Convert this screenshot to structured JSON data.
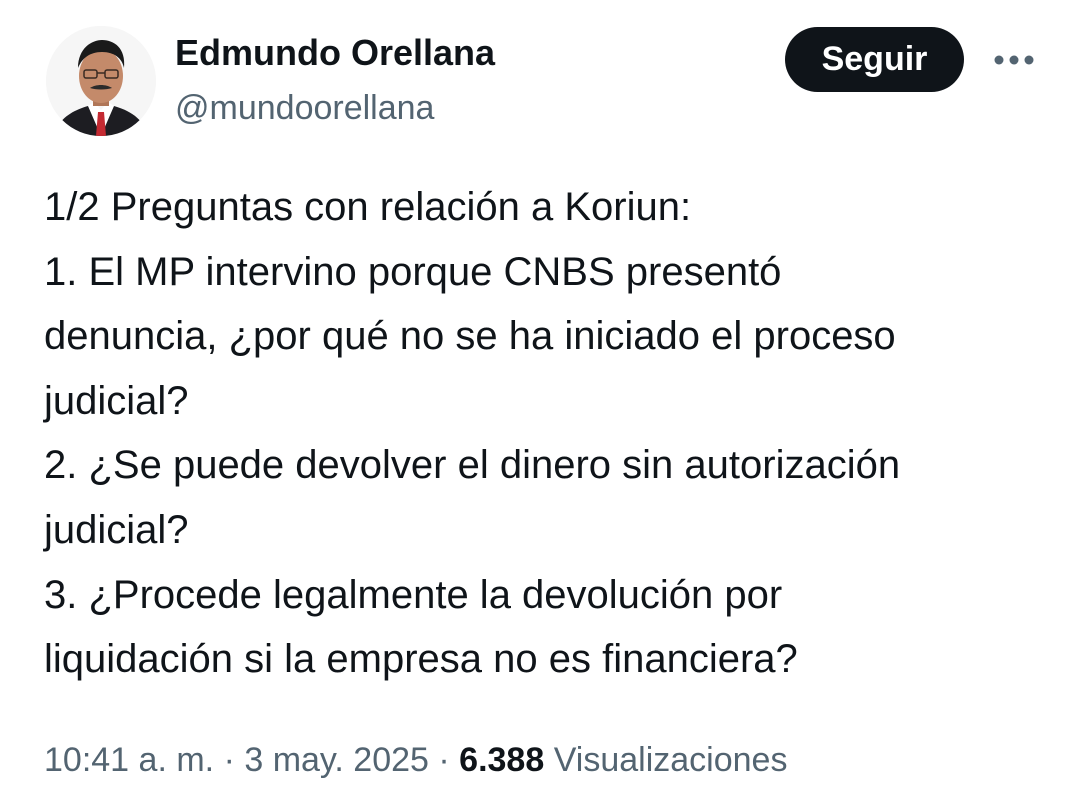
{
  "author": {
    "display_name": "Edmundo Orellana",
    "handle": "@mundoorellana",
    "avatar_icon": "profile-photo"
  },
  "actions": {
    "follow_label": "Seguir",
    "more_icon": "more-horizontal-icon"
  },
  "tweet": {
    "lines": [
      "1/2 Preguntas con relación a Koriun:",
      "1. El MP intervino porque CNBS presentó",
      "denuncia, ¿por qué no se ha iniciado el proceso",
      "judicial?",
      "2. ¿Se puede devolver el dinero sin autorización",
      "judicial?",
      "3. ¿Procede legalmente la devolución por",
      "liquidación si la empresa  no es financiera?"
    ]
  },
  "meta": {
    "time": "10:41 a. m.",
    "separator": "·",
    "date": "3 may. 2025",
    "views_count": "6.388",
    "views_label": "Visualizaciones"
  },
  "colors": {
    "text_primary": "#0f1419",
    "text_secondary": "#536471",
    "button_bg": "#0f1419",
    "button_text": "#ffffff"
  }
}
